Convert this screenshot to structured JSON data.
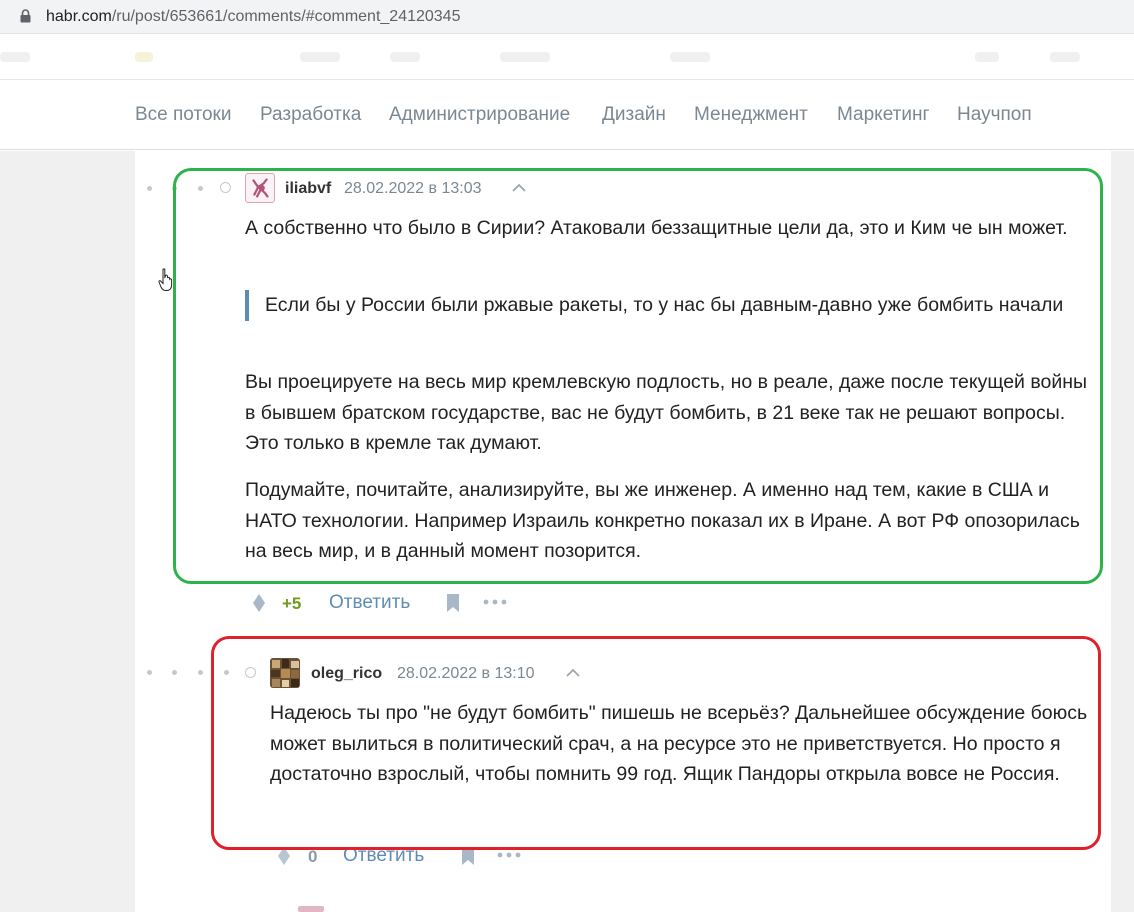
{
  "browser": {
    "url_host": "habr.com",
    "url_path": "/ru/post/653661/comments/#comment_24120345"
  },
  "nav": {
    "items": [
      {
        "label": "Все потоки"
      },
      {
        "label": "Разработка"
      },
      {
        "label": "Администрирование"
      },
      {
        "label": "Дизайн"
      },
      {
        "label": "Менеджмент"
      },
      {
        "label": "Маркетинг"
      },
      {
        "label": "Научпоп"
      }
    ]
  },
  "comments": [
    {
      "author": "iliabvf",
      "date": "28.02.2022 в 13:03",
      "para1": "А собственно что было в Сирии? Атаковали беззащитные цели да, это и Ким че ын может.",
      "quote": "Если бы у России были ржавые ракеты, то у нас бы давным-давно уже бомбить начали",
      "para2": "Вы проецируете на весь мир кремлевскую подлость, но в реале, даже после текущей войны в бывшем братском государстве, вас не будут бомбить, в 21 веке так не решают вопросы. Это только в кремле так думают.",
      "para3": "Подумайте, почитайте, анализируйте, вы же инженер. А именно над тем, какие в США и НАТО технологии. Например Израиль конкретно показал их в Иране. А вот РФ опозорилась на весь мир, и в данный момент позорится.",
      "score": "+5",
      "reply_label": "Ответить",
      "highlight_color": "#2db34a"
    },
    {
      "author": "oleg_rico",
      "date": "28.02.2022 в 13:10",
      "para1": "Надеюсь ты про \"не будут бомбить\" пишешь не всерьёз? Дальнейшее обсуждение боюсь может вылиться в политический срач, а на ресурсе это не приветствуется. Но просто я достаточно взрослый, чтобы помнить 99 год. Ящик Пандоры открыла вовсе не Россия.",
      "score": "0",
      "reply_label": "Ответить",
      "highlight_color": "#e0202a"
    }
  ],
  "colors": {
    "link": "#5e8cb3",
    "nav_text": "#7b8893",
    "score_positive": "#6f9a1e",
    "quote_bar": "#5b8db3"
  }
}
